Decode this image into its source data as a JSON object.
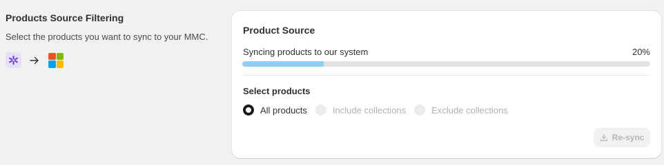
{
  "section": {
    "title": "Products Source Filtering",
    "description": "Select the products you want to sync to your MMC."
  },
  "icons": {
    "source": "app-asterisk-icon",
    "arrow": "arrow-right-icon",
    "target": "microsoft-logo-icon"
  },
  "card": {
    "title": "Product Source",
    "sync": {
      "label": "Syncing products to our system",
      "percent_text": "20%",
      "progress": 0.2
    },
    "select_title": "Select products",
    "options": [
      {
        "label": "All products",
        "selected": true,
        "disabled": false
      },
      {
        "label": "Include collections",
        "selected": false,
        "disabled": true
      },
      {
        "label": "Exclude collections",
        "selected": false,
        "disabled": true
      }
    ],
    "resync_label": "Re-sync"
  },
  "colors": {
    "progress_fill": "#90cdf4",
    "app_icon_bg": "#e7defa",
    "app_icon_fg": "#6b3fd4"
  }
}
